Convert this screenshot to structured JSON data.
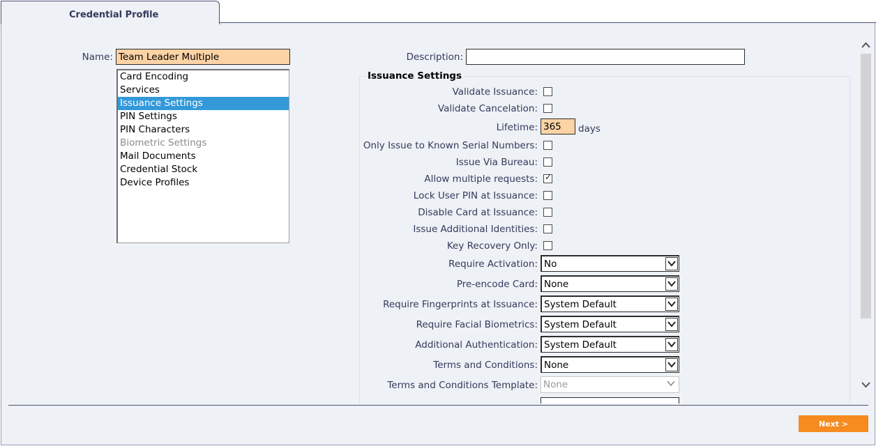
{
  "tab": {
    "title": "Credential Profile"
  },
  "form": {
    "name_label": "Name:",
    "name_value": "Team Leader Multiple",
    "description_label": "Description:",
    "description_value": ""
  },
  "sections": [
    {
      "label": "Card Encoding"
    },
    {
      "label": "Services"
    },
    {
      "label": "Issuance Settings",
      "selected": true
    },
    {
      "label": "PIN Settings"
    },
    {
      "label": "PIN Characters"
    },
    {
      "label": "Biometric Settings",
      "disabled": true
    },
    {
      "label": "Mail Documents"
    },
    {
      "label": "Credential Stock"
    },
    {
      "label": "Device Profiles"
    }
  ],
  "issuance": {
    "title": "Issuance Settings",
    "validate_issuance": {
      "label": "Validate Issuance:",
      "checked": false
    },
    "validate_cancelation": {
      "label": "Validate Cancelation:",
      "checked": false
    },
    "lifetime": {
      "label": "Lifetime:",
      "value": "365",
      "unit": "days"
    },
    "known_serials": {
      "label": "Only Issue to Known Serial Numbers:",
      "checked": false
    },
    "via_bureau": {
      "label": "Issue Via Bureau:",
      "checked": false
    },
    "multiple_requests": {
      "label": "Allow multiple requests:",
      "checked": true
    },
    "lock_pin": {
      "label": "Lock User PIN at Issuance:",
      "checked": false
    },
    "disable_card": {
      "label": "Disable Card at Issuance:",
      "checked": false
    },
    "additional_identities": {
      "label": "Issue Additional Identities:",
      "checked": false
    },
    "key_recovery": {
      "label": "Key Recovery Only:",
      "checked": false
    },
    "require_activation": {
      "label": "Require Activation:",
      "value": "No"
    },
    "pre_encode": {
      "label": "Pre-encode Card:",
      "value": "None"
    },
    "fingerprints": {
      "label": "Require Fingerprints at Issuance:",
      "value": "System Default"
    },
    "facial": {
      "label": "Require Facial Biometrics:",
      "value": "System Default"
    },
    "additional_auth": {
      "label": "Additional Authentication:",
      "value": "System Default"
    },
    "terms": {
      "label": "Terms and Conditions:",
      "value": "None"
    },
    "terms_template": {
      "label": "Terms and Conditions Template:",
      "value": "None",
      "disabled": true
    }
  },
  "buttons": {
    "next": "Next >"
  },
  "colors": {
    "accent": "#f68b1f",
    "selection": "#3399d9",
    "highlight_field": "#fcd3a5"
  }
}
